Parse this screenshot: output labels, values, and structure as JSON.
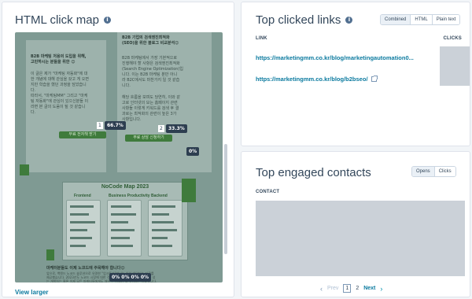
{
  "left": {
    "title": "HTML click map",
    "view_larger": "View larger",
    "heatmap": {
      "headline_kr": "B2B 기업의 검색엔진최적화\n(SEO)을 위한 블로그 비교분석😊",
      "para1": "B2B 마케팅 저용의 도입을 위해,\n고민하시는 분들을 위한 😊",
      "para2": "이 글은 제가 \"마케팅 자동화\"에 대\n한 개념에 대해 관심을 갖고 게 오면\n지만 학습을 했던 과정을 담았습니\n다.\n따라서, \"마케팅MM\" 그리고 \"마케\n팅 자동화\"에 관심이 있으신분들 이\n라면 본 글의 도움이 될 것 같습니\n다.",
      "para3": "B2B 마케팅에서 가장 기본적으로\n진행해야 할 사항은 검색엔진최적화\n(Search Engine Optimization)입\n니다. 이는 B2B 마케팅 분만 아니\n라 B2C에서도 마찬가지 일 것 같습\n니다.",
      "para4": "해당 흐름을 보며도 당연히, 이와 같\n고로 인터넷의 모는 홈페이지 관련\n사항들 이렇게 키워드를 검색 후 결\n과로는 최적화의 관련이 높은 3가\n사항입니다.",
      "btn1": "무료 전자책 받기",
      "btn2": "무료 상담 신청하기",
      "nocode_title": "NoCode Map 2023",
      "nocode_sub1": "Frontend",
      "nocode_sub2": "Business Productivity",
      "nocode_sub3": "Backend",
      "footer_head": "마케터분들도 이제 노코드에 주목해야 합니다😊",
      "footer_text": "앞으로, 백엔드 노코드 솔루션으로 유명한 \"업크트라\"에서는 이하 데이터는 자료를\n제공했습니다. 2023년도 노코드 시장에 대한 각각 지도를 제작했는데요. 마케팅 성\n는 개발자는 물론 이제 모든 마케터들에게도 매우 큰 기회가 될 것이라는 자료입니다.",
      "pct_sidebar": "0%",
      "pct_1_num": "1",
      "pct_1_val": "66.7%",
      "pct_2_num": "2",
      "pct_2_val": "33.3%",
      "pct_bottom": "0% 0% 0% 0%"
    }
  },
  "links": {
    "title": "Top clicked links",
    "toggle": [
      "Combined",
      "HTML",
      "Plain text"
    ],
    "col_link": "LINK",
    "col_clicks": "CLICKS",
    "rows": [
      "https://marketingmm.co.kr/blog/marketingautomation0...",
      "https://marketingmm.co.kr/blog/b2bseo/"
    ]
  },
  "contacts": {
    "title": "Top engaged contacts",
    "toggle": [
      "Opens",
      "Clicks"
    ],
    "col_contact": "CONTACT",
    "pager": {
      "prev": "Prev",
      "current": "1",
      "page2": "2",
      "next": "Next"
    }
  }
}
